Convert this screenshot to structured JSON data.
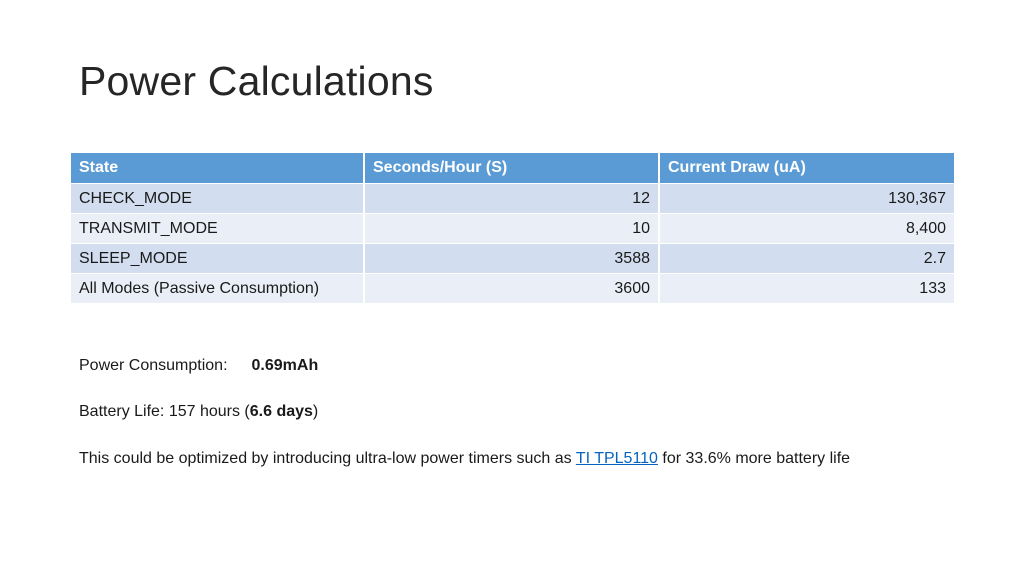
{
  "title": "Power Calculations",
  "table": {
    "headers": [
      "State",
      "Seconds/Hour (S)",
      "Current Draw (uA)"
    ],
    "rows": [
      [
        "CHECK_MODE",
        "12",
        "130,367"
      ],
      [
        "TRANSMIT_MODE",
        "10",
        "8,400"
      ],
      [
        "SLEEP_MODE",
        "3588",
        "2.7"
      ],
      [
        "All Modes (Passive Consumption)",
        "3600",
        "133"
      ]
    ]
  },
  "power": {
    "label": "Power Consumption:",
    "value": "0.69mAh"
  },
  "battery": {
    "prefix": "Battery Life: 157 hours (",
    "days": "6.6 days",
    "suffix": ")"
  },
  "optimization": {
    "prefix": "This could be optimized by introducing ultra-low power timers such as ",
    "link_text": "TI TPL5110",
    "suffix": " for 33.6% more battery life",
    "link_color": "#0563c1"
  },
  "colors": {
    "header_bg": "#5b9bd5",
    "row_odd_bg": "#d2deef",
    "row_even_bg": "#eaeff7"
  }
}
